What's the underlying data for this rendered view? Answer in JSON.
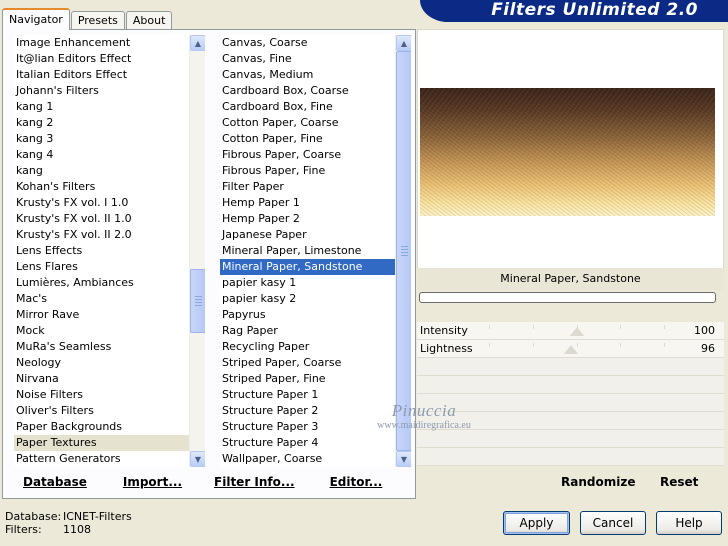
{
  "banner": {
    "title": "Filters Unlimited 2.0"
  },
  "tabs": [
    {
      "label": "Navigator",
      "active": true
    },
    {
      "label": "Presets",
      "active": false
    },
    {
      "label": "About",
      "active": false
    }
  ],
  "categories": {
    "selected": "Paper Textures",
    "items": [
      "Image Enhancement",
      "It@lian Editors Effect",
      "Italian Editors Effect",
      "Johann's Filters",
      "kang 1",
      "kang 2",
      "kang 3",
      "kang 4",
      "kang",
      "Kohan's Filters",
      "Krusty's FX vol. I 1.0",
      "Krusty's FX vol. II 1.0",
      "Krusty's FX vol. II 2.0",
      "Lens Effects",
      "Lens Flares",
      "Lumières, Ambiances",
      "Mac's",
      "Mirror Rave",
      "Mock",
      "MuRa's Seamless",
      "Neology",
      "Nirvana",
      "Noise Filters",
      "Oliver's Filters",
      "Paper Backgrounds",
      "Paper Textures",
      "Pattern Generators"
    ]
  },
  "filters": {
    "selected": "Mineral Paper, Sandstone",
    "items": [
      "Canvas, Coarse",
      "Canvas, Fine",
      "Canvas, Medium",
      "Cardboard Box, Coarse",
      "Cardboard Box, Fine",
      "Cotton Paper, Coarse",
      "Cotton Paper, Fine",
      "Fibrous Paper, Coarse",
      "Fibrous Paper, Fine",
      "Filter Paper",
      "Hemp Paper 1",
      "Hemp Paper 2",
      "Japanese Paper",
      "Mineral Paper, Limestone",
      "Mineral Paper, Sandstone",
      "papier kasy 1",
      "papier kasy 2",
      "Papyrus",
      "Rag Paper",
      "Recycling Paper",
      "Striped Paper, Coarse",
      "Striped Paper, Fine",
      "Structure Paper 1",
      "Structure Paper 2",
      "Structure Paper 3",
      "Structure Paper 4",
      "Wallpaper, Coarse"
    ]
  },
  "left_links": {
    "database": "Database",
    "import": "Import...",
    "filter_info": "Filter Info...",
    "editor": "Editor..."
  },
  "preview": {
    "filter_name": "Mineral Paper, Sandstone"
  },
  "sliders": [
    {
      "label": "Intensity",
      "value": 100,
      "level": 0.5
    },
    {
      "label": "Lightness",
      "value": 96,
      "level": 0.47
    }
  ],
  "right_links": {
    "randomize": "Randomize",
    "reset": "Reset"
  },
  "watermark": {
    "name": "Pinuccia",
    "url": "www.maidiregrafica.eu"
  },
  "status": {
    "database_label": "Database:",
    "database_value": "ICNET-Filters",
    "filters_label": "Filters:",
    "filters_value": "1108"
  },
  "buttons": {
    "apply": "Apply",
    "cancel": "Cancel",
    "help": "Help"
  },
  "icons": {
    "scroll_up": "scroll-up-arrow",
    "scroll_down": "scroll-down-arrow"
  },
  "colors": {
    "banner": "#0a2a86",
    "selection": "#316ac5",
    "tab_accent": "#e68b2c"
  }
}
